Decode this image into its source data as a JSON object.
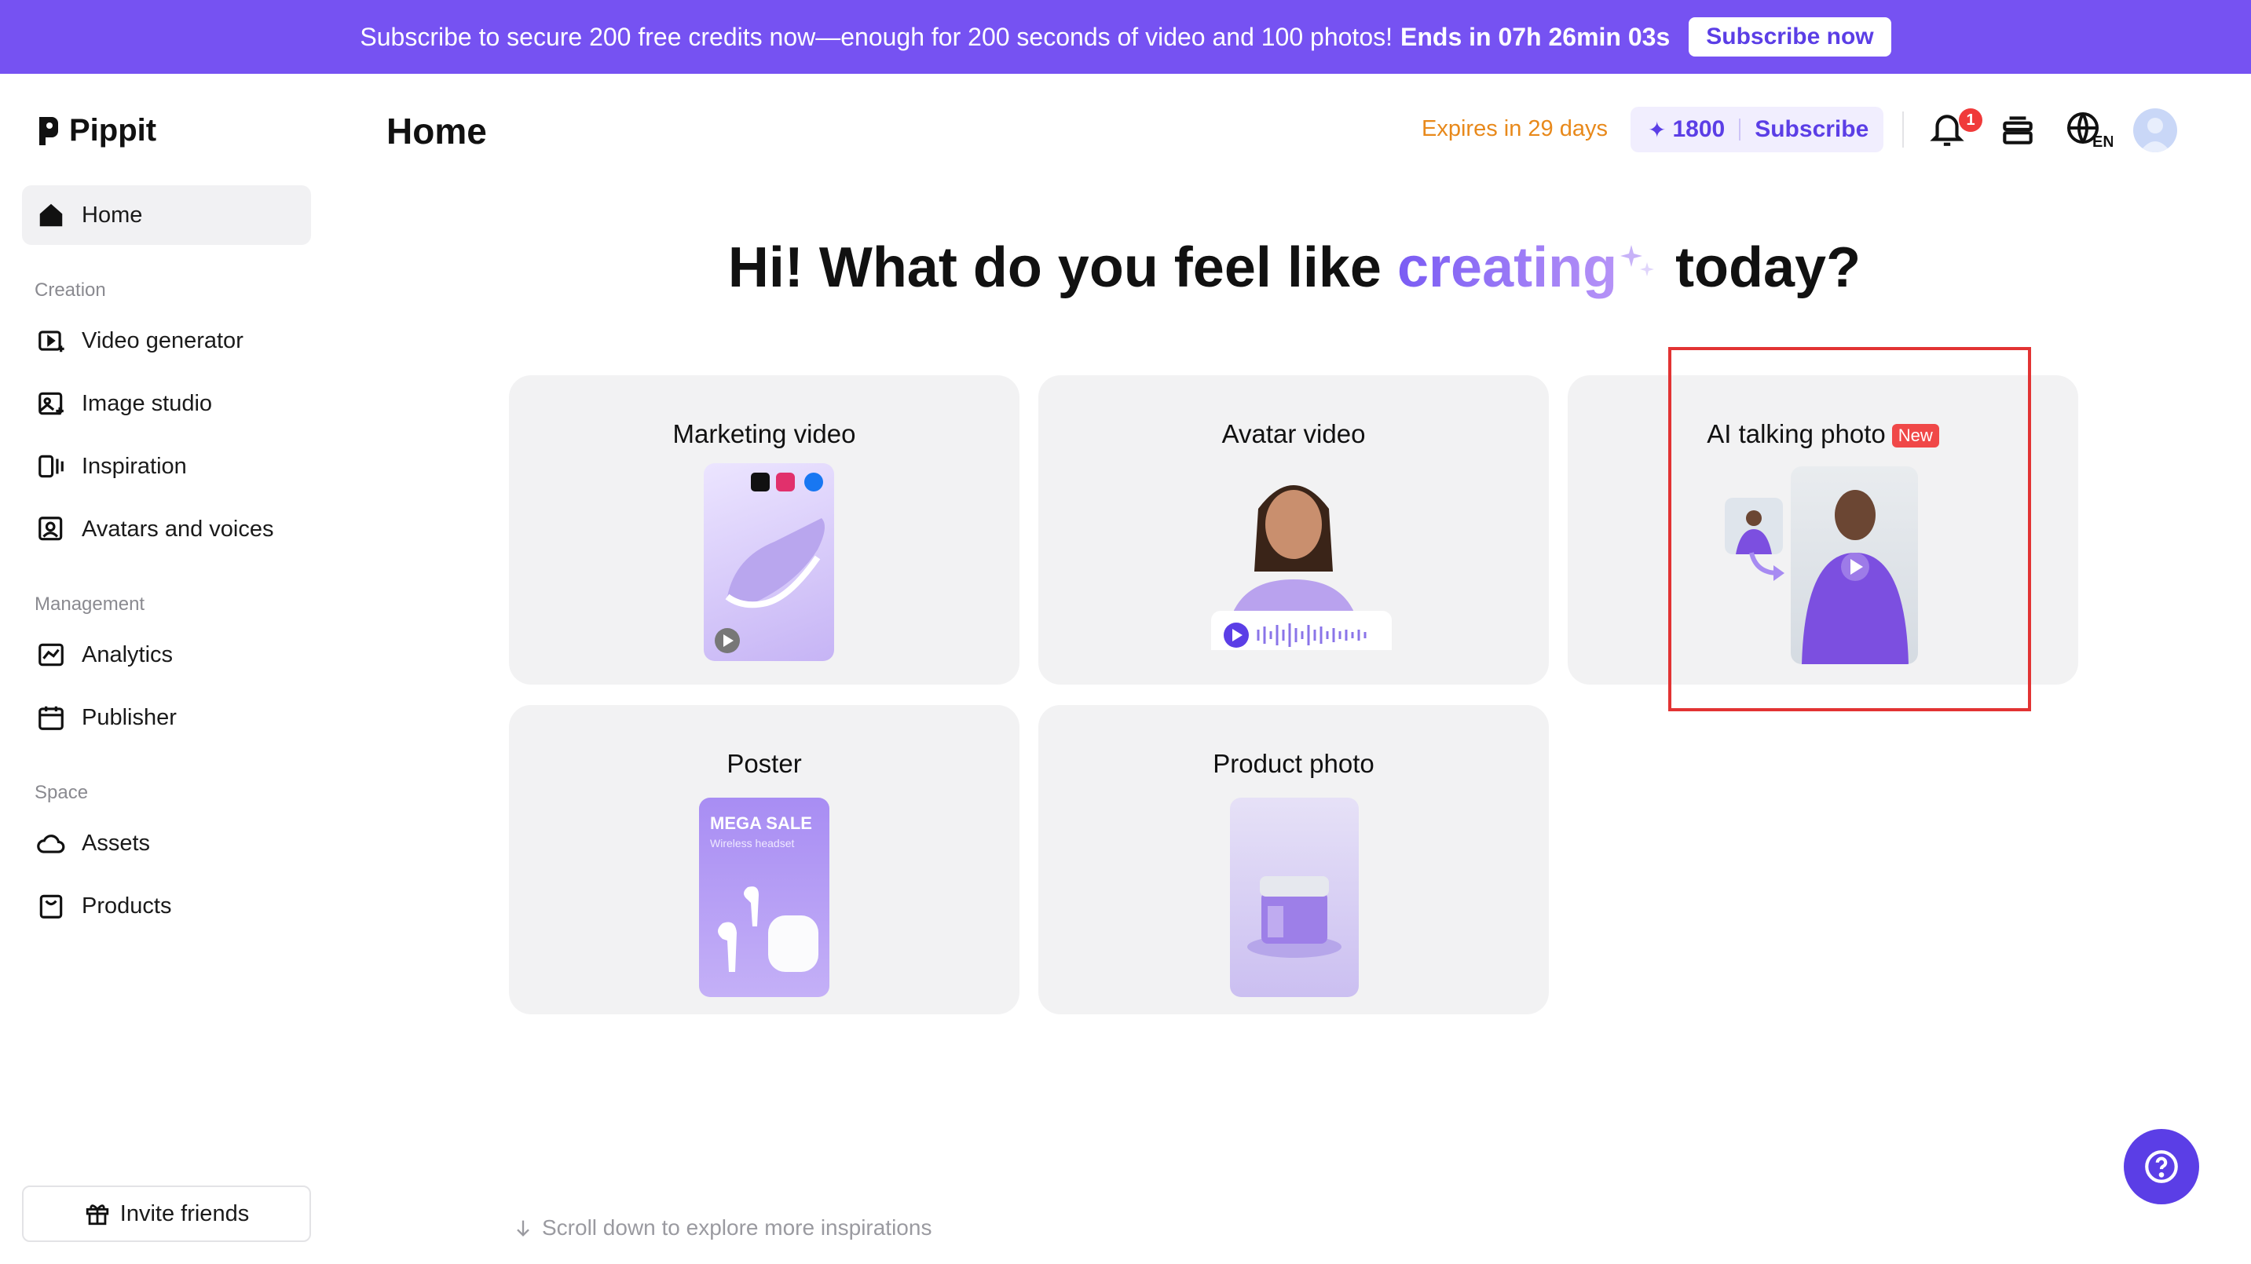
{
  "banner": {
    "message": "Subscribe to secure 200 free credits now—enough for 200 seconds of video and 100 photos!",
    "countdown": "Ends in 07h 26min 03s",
    "button": "Subscribe now"
  },
  "brand": {
    "name": "Pippit"
  },
  "sidebar": {
    "home": "Home",
    "sections": {
      "creation": "Creation",
      "management": "Management",
      "space": "Space"
    },
    "creation_items": [
      "Video generator",
      "Image studio",
      "Inspiration",
      "Avatars and voices"
    ],
    "management_items": [
      "Analytics",
      "Publisher"
    ],
    "space_items": [
      "Assets",
      "Products"
    ],
    "invite": "Invite friends"
  },
  "header": {
    "title": "Home",
    "expires": "Expires in 29 days",
    "credits": "1800",
    "subscribe": "Subscribe",
    "notification_count": "1",
    "language": "EN"
  },
  "headline": {
    "before": "Hi! What do you feel like",
    "accent": "creating",
    "after": "today?"
  },
  "cards": {
    "marketing": "Marketing video",
    "avatar": "Avatar video",
    "talking": "AI talking photo",
    "talking_badge": "New",
    "poster": "Poster",
    "poster_sale": "MEGA SALE",
    "poster_sub": "Wireless headset",
    "product": "Product photo"
  },
  "footer": {
    "scroll_hint": "Scroll down to explore more inspirations"
  },
  "colors": {
    "accent": "#7652f2",
    "highlight": "#e23333",
    "expires": "#e8891b"
  }
}
